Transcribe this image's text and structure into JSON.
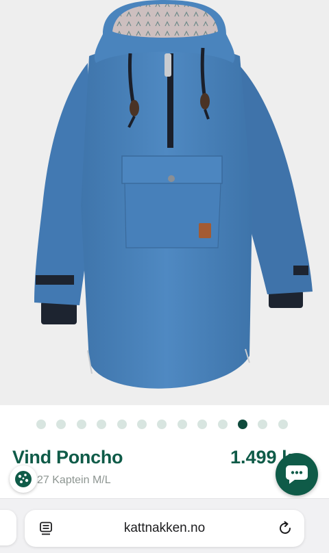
{
  "product": {
    "name": "Vind Poncho",
    "price": "1.499 kr",
    "variant": "27 Kaptein M/L"
  },
  "carousel": {
    "total": 13,
    "active_index": 10
  },
  "browser": {
    "url": "kattnakken.no"
  },
  "icons": {
    "cookie": "cookie-icon",
    "chat": "chat-bubble-icon",
    "reader": "reader-mode-icon",
    "reload": "reload-icon"
  },
  "colors": {
    "brand_green": "#0f5b48",
    "dot_inactive": "#d8e5e0",
    "dot_active": "#0f4a3c",
    "poncho_blue": "#4a84bd"
  }
}
